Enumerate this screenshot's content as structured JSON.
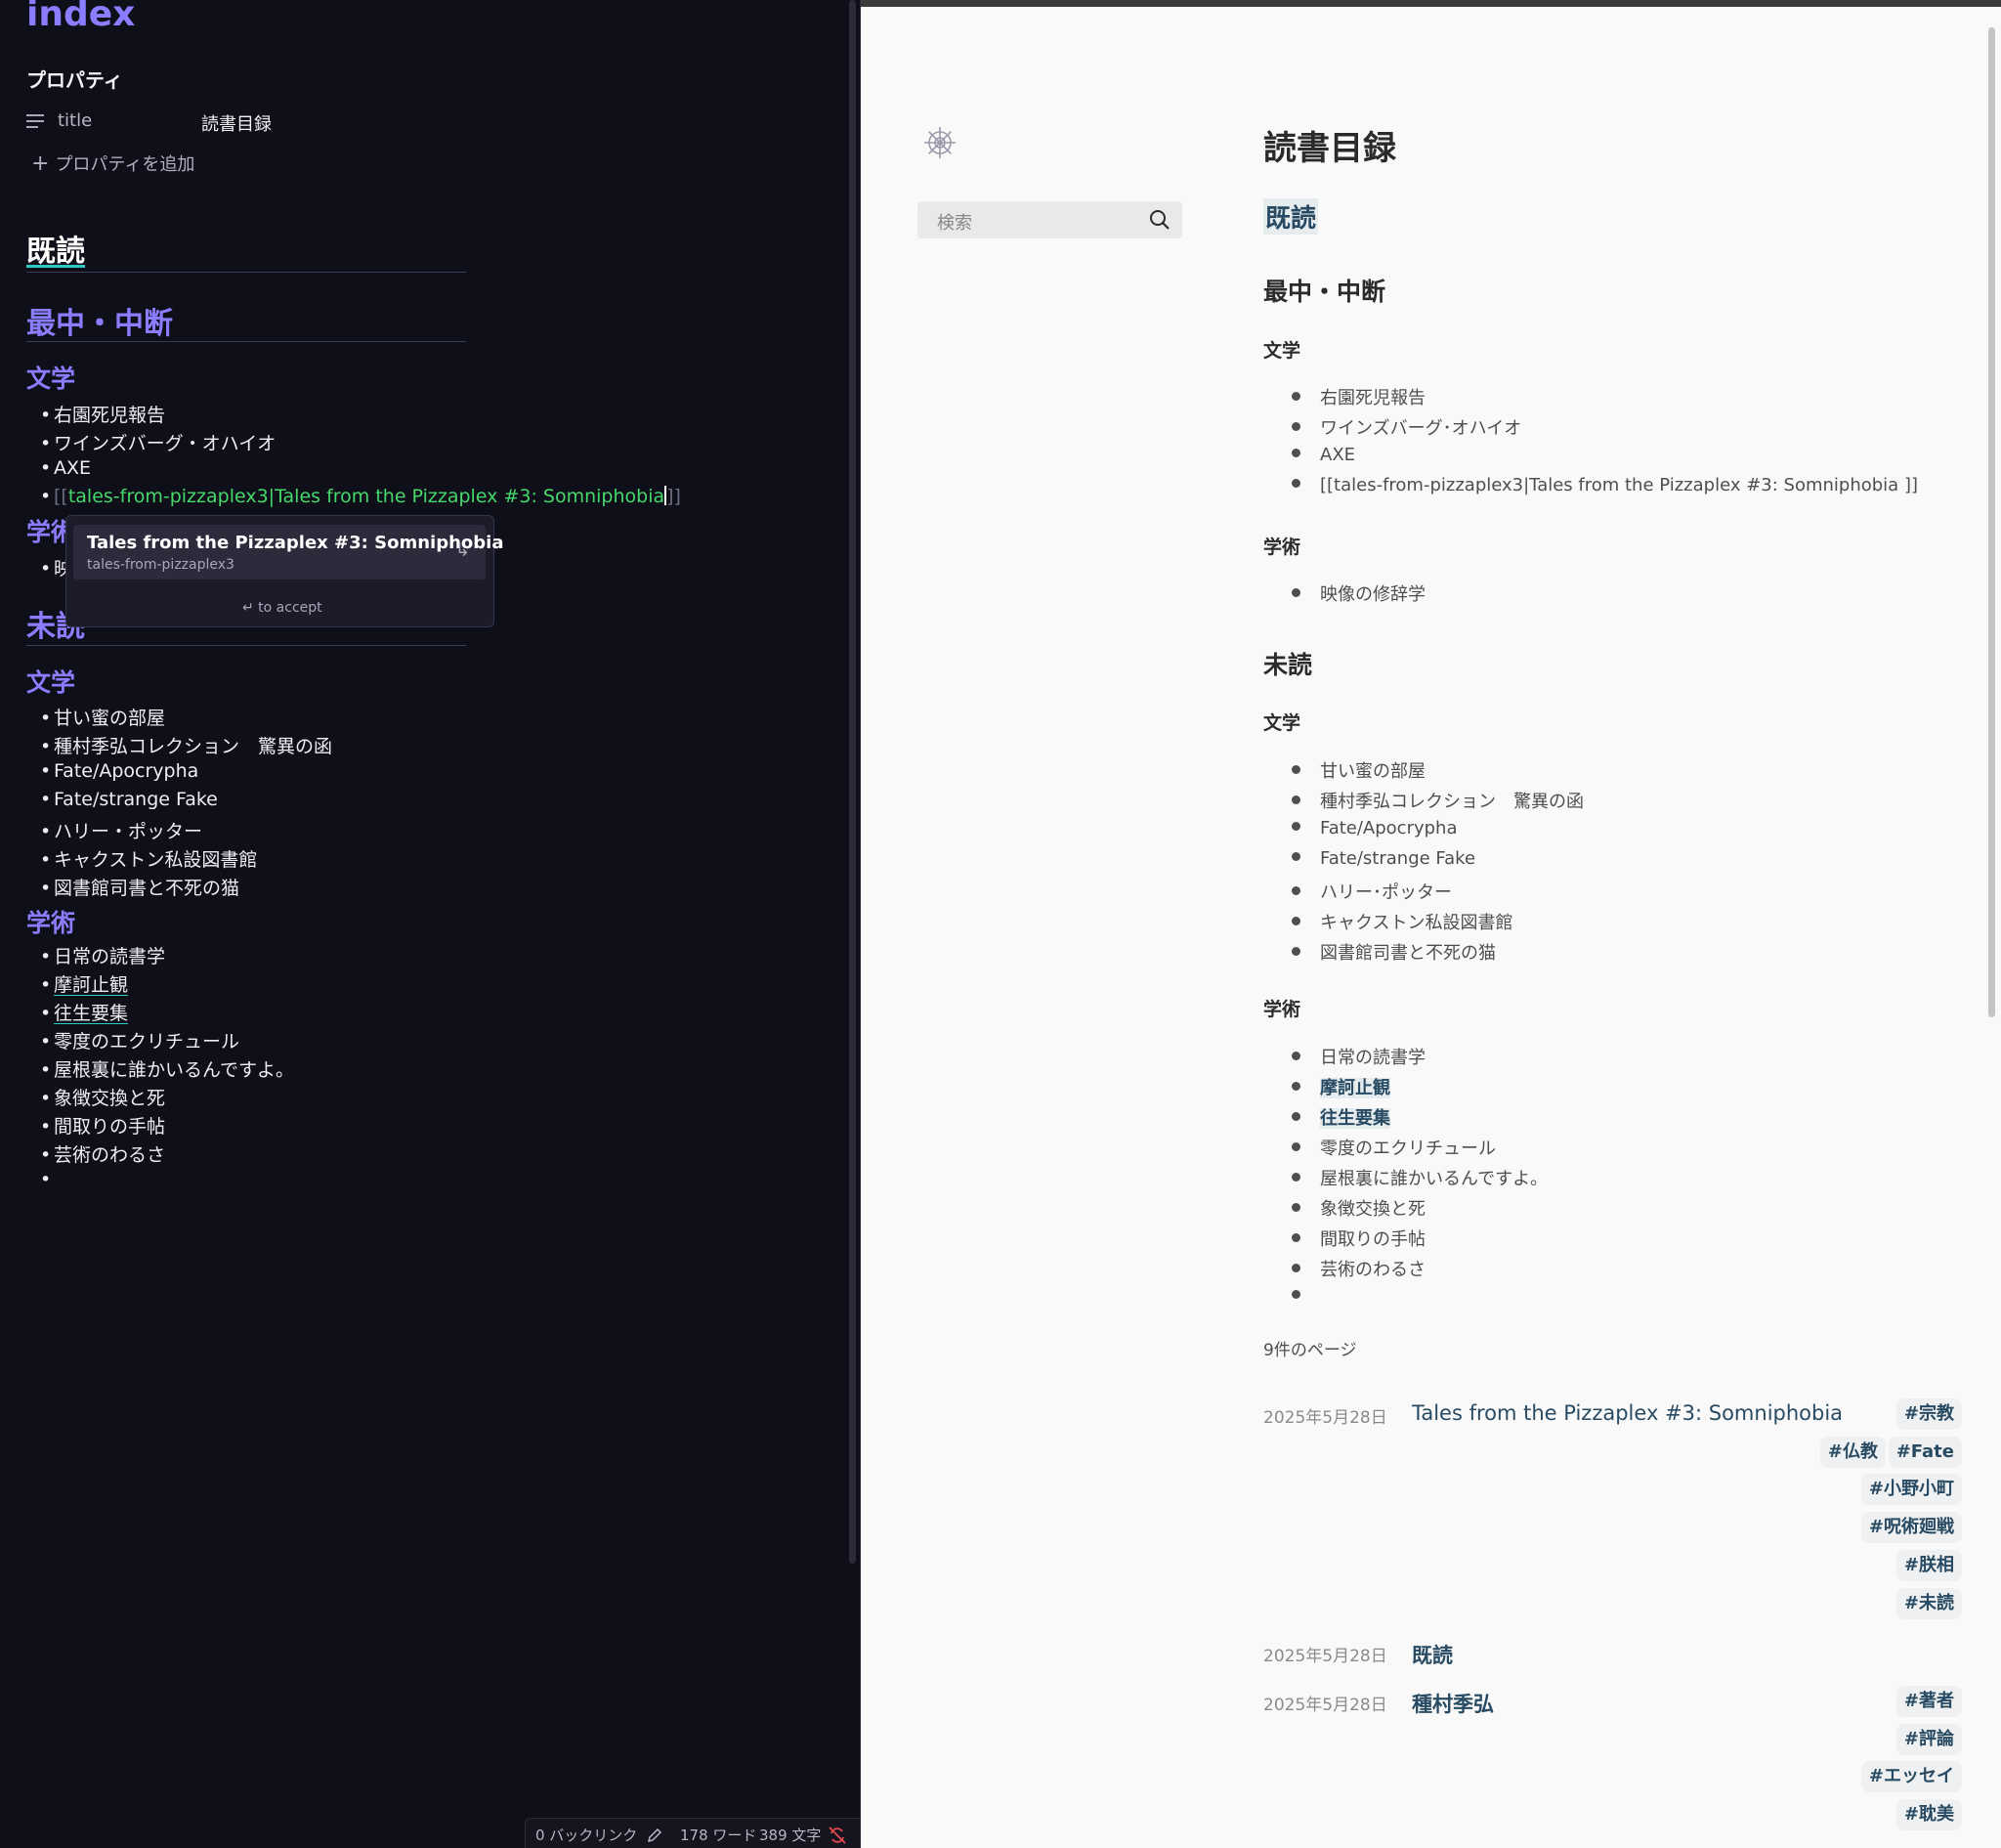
{
  "editor": {
    "title": "index",
    "properties_heading": "プロパティ",
    "property_key": "title",
    "property_value": "読書目録",
    "add_property": "プロパティを追加",
    "h_read": "既読",
    "h_reading": "最中・中断",
    "h_lit": "文学",
    "reading_lit": [
      "右園死児報告",
      "ワインズバーグ・オハイオ",
      "AXE"
    ],
    "link_open": "[[",
    "link_text": "tales-from-pizzaplex3|Tales from the Pizzaplex #3: Somniphobia",
    "link_close": "]]",
    "h_acad_partial": "学術",
    "acad_partial_item": "映",
    "h_unread": "未読",
    "unread_lit": [
      "甘い蜜の部屋",
      "種村季弘コレクション　驚異の函",
      "Fate/Apocrypha",
      "Fate/strange Fake",
      "ハリー・ポッター",
      "キャクストン私設図書館",
      "図書館司書と不死の猫"
    ],
    "h_acad": "学術",
    "unread_acad": [
      "日常の読書学",
      "摩訶止観",
      "往生要集",
      "零度のエクリチュール",
      "屋根裏に誰かいるんですよ。",
      "象徴交換と死",
      "間取りの手帖",
      "芸術のわるさ"
    ],
    "bullet": "•",
    "suggest": {
      "title": "Tales from the Pizzaplex #3: Somniphobia",
      "subtitle": "tales-from-pizzaplex3",
      "arrow": "↳",
      "hint": "↵ to accept"
    },
    "status": {
      "backlinks": "0 バックリンク",
      "words": "178 ワード",
      "chars": "389 文字"
    }
  },
  "preview": {
    "search_placeholder": "検索",
    "title": "読書目録",
    "h_read": "既読",
    "h_reading": "最中・中断",
    "h_lit": "文学",
    "reading_lit": [
      "右園死児報告",
      "ワインズバーグ･オハイオ",
      "AXE",
      "[[tales-from-pizzaplex3|Tales from the Pizzaplex #3: Somniphobia ]]"
    ],
    "h_acad": "学術",
    "reading_acad": [
      "映像の修辞学"
    ],
    "h_unread": "未読",
    "unread_lit": [
      "甘い蜜の部屋",
      "種村季弘コレクション　驚異の函",
      "Fate/Apocrypha",
      "Fate/strange Fake",
      "ハリー･ポッター",
      "キャクストン私設図書館",
      "図書館司書と不死の猫"
    ],
    "unread_acad": [
      "日常の読書学",
      "摩訶止観",
      "往生要集",
      "零度のエクリチュール",
      "屋根裏に誰かいるんですよ。",
      "象徴交換と死",
      "間取りの手帖",
      "芸術のわるさ"
    ],
    "page_count": "9件のページ",
    "pages": [
      {
        "date": "2025年5月28日",
        "title": "Tales from the Pizzaplex #3: Somniphobia",
        "tags": [
          "#宗教",
          "#仏教",
          "#Fate",
          "#小野小町",
          "#呪術廻戦",
          "#朕相",
          "#未読"
        ]
      },
      {
        "date": "2025年5月28日",
        "title": "既読",
        "tags": []
      },
      {
        "date": "2025年5月28日",
        "title": "種村季弘",
        "tags": [
          "#著者",
          "#評論",
          "#エッセイ",
          "#耽美"
        ]
      }
    ]
  },
  "colors": {
    "editor_bg": "#0f0f1a",
    "heading_accent": "#8a7dff",
    "link_green": "#45d86a",
    "preview_link": "#284b63",
    "preview_bg": "#faf9f9"
  },
  "icons": [
    "list-icon",
    "plus-icon",
    "search-icon",
    "logo-icon",
    "pencil-icon",
    "sync-off-icon",
    "arrow-icon"
  ]
}
